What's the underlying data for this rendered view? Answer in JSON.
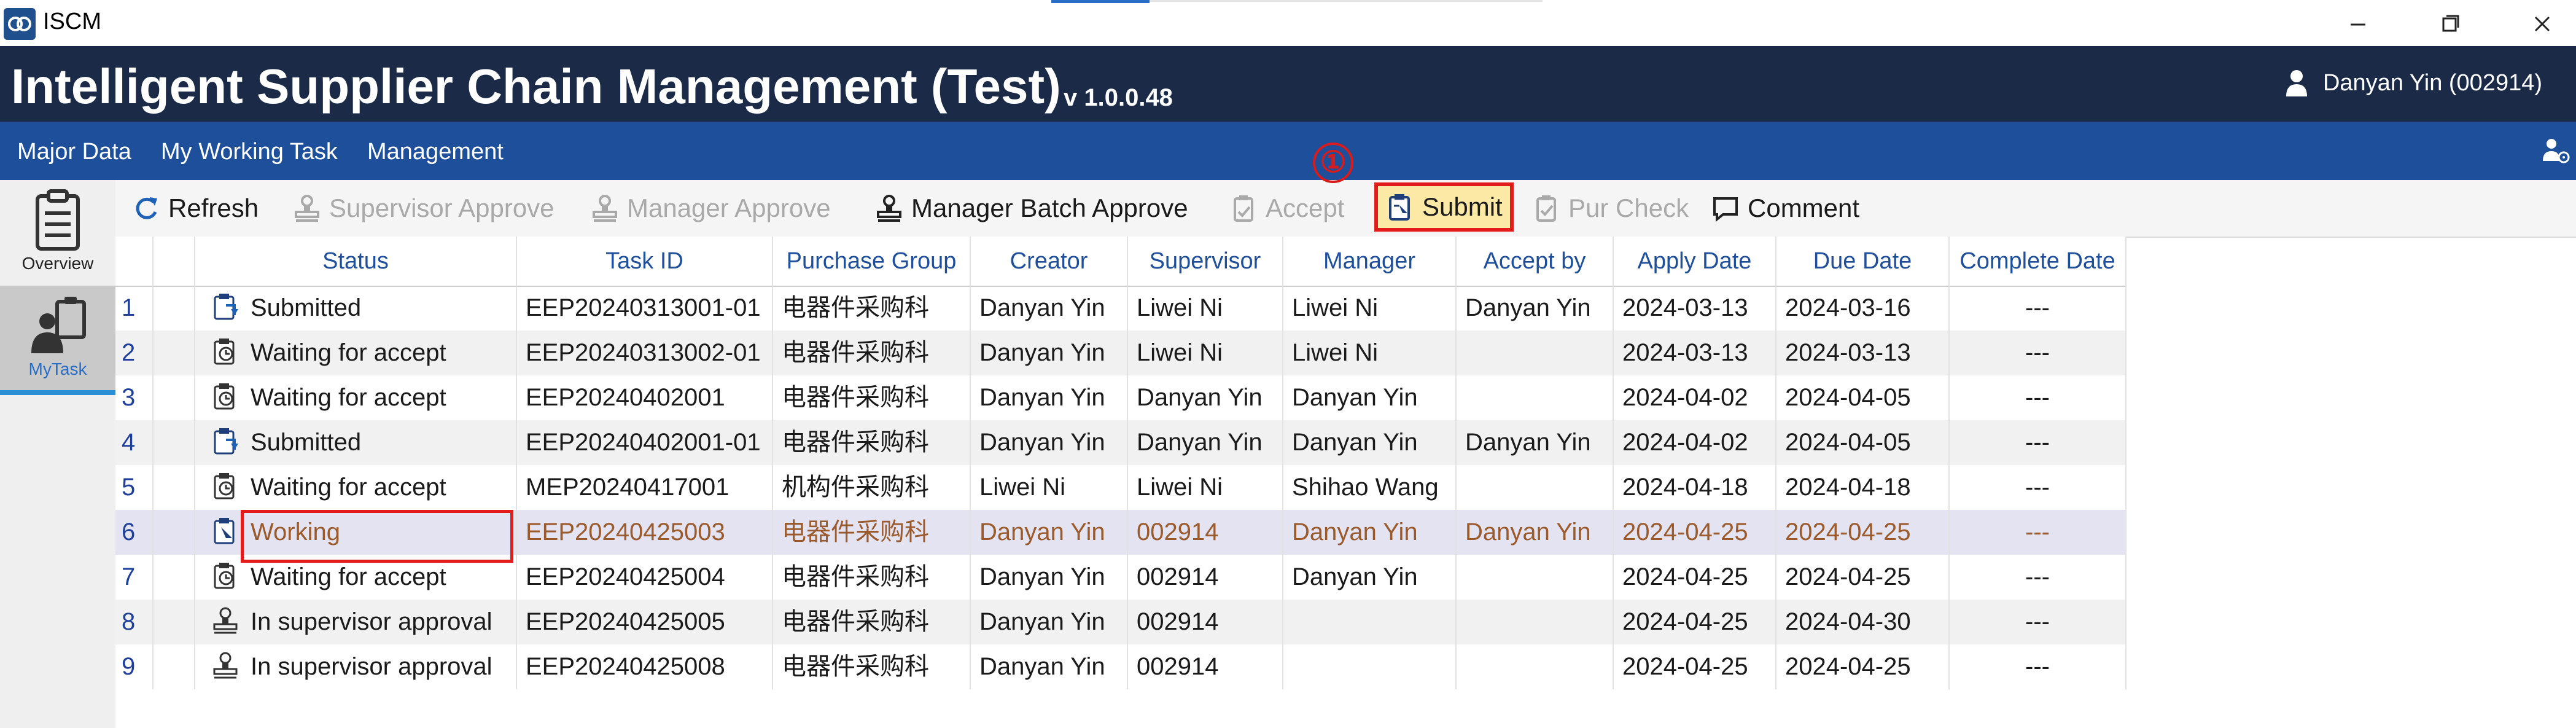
{
  "window": {
    "title": "ISCM",
    "minimize_icon": "minimize-icon",
    "maximize_icon": "restore-icon",
    "close_icon": "close-icon"
  },
  "header": {
    "title": "Intelligent Supplier Chain Management (Test)",
    "version": "v 1.0.0.48",
    "user": "Danyan Yin (002914)"
  },
  "menu": {
    "items": [
      "Major Data",
      "My Working Task",
      "Management"
    ]
  },
  "nav": {
    "items": [
      {
        "label": "Overview",
        "icon": "clipboard-icon"
      },
      {
        "label": "MyTask",
        "icon": "person-task-icon"
      }
    ]
  },
  "toolbar": {
    "refresh": "Refresh",
    "supervisor_approve": "Supervisor Approve",
    "manager_approve": "Manager Approve",
    "manager_batch_approve": "Manager Batch Approve",
    "accept": "Accept",
    "submit": "Submit",
    "pur_check": "Pur Check",
    "comment": "Comment",
    "callout": "①"
  },
  "table": {
    "columns": [
      "Status",
      "Task ID",
      "Purchase Group",
      "Creator",
      "Supervisor",
      "Manager",
      "Accept by",
      "Apply Date",
      "Due Date",
      "Complete Date"
    ],
    "rows": [
      {
        "num": "1",
        "status_icon": "submitted",
        "status": "Submitted",
        "task_id": "EEP20240313001-01",
        "group": "电器件采购科",
        "creator": "Danyan Yin",
        "supervisor": "Liwei Ni",
        "manager": "Liwei Ni",
        "accept_by": "Danyan Yin",
        "apply": "2024-03-13",
        "due": "2024-03-16",
        "complete": "---"
      },
      {
        "num": "2",
        "status_icon": "waiting",
        "status": "Waiting for accept",
        "task_id": "EEP20240313002-01",
        "group": "电器件采购科",
        "creator": "Danyan Yin",
        "supervisor": "Liwei Ni",
        "manager": "Liwei Ni",
        "accept_by": "",
        "apply": "2024-03-13",
        "due": "2024-03-13",
        "complete": "---"
      },
      {
        "num": "3",
        "status_icon": "waiting",
        "status": "Waiting for accept",
        "task_id": "EEP20240402001",
        "group": "电器件采购科",
        "creator": "Danyan Yin",
        "supervisor": "Danyan Yin",
        "manager": "Danyan Yin",
        "accept_by": "",
        "apply": "2024-04-02",
        "due": "2024-04-05",
        "complete": "---"
      },
      {
        "num": "4",
        "status_icon": "submitted",
        "status": "Submitted",
        "task_id": "EEP20240402001-01",
        "group": "电器件采购科",
        "creator": "Danyan Yin",
        "supervisor": "Danyan Yin",
        "manager": "Danyan Yin",
        "accept_by": "Danyan Yin",
        "apply": "2024-04-02",
        "due": "2024-04-05",
        "complete": "---"
      },
      {
        "num": "5",
        "status_icon": "waiting",
        "status": "Waiting for accept",
        "task_id": "MEP20240417001",
        "group": "机构件采购科",
        "creator": "Liwei Ni",
        "supervisor": "Liwei Ni",
        "manager": "Shihao Wang",
        "accept_by": "",
        "apply": "2024-04-18",
        "due": "2024-04-18",
        "complete": "---"
      },
      {
        "num": "6",
        "status_icon": "working",
        "status": "Working",
        "task_id": "EEP20240425003",
        "group": "电器件采购科",
        "creator": "Danyan Yin",
        "supervisor": "002914",
        "manager": "Danyan Yin",
        "accept_by": "Danyan Yin",
        "apply": "2024-04-25",
        "due": "2024-04-25",
        "complete": "---"
      },
      {
        "num": "7",
        "status_icon": "waiting",
        "status": "Waiting for accept",
        "task_id": "EEP20240425004",
        "group": "电器件采购科",
        "creator": "Danyan Yin",
        "supervisor": "002914",
        "manager": "Danyan Yin",
        "accept_by": "",
        "apply": "2024-04-25",
        "due": "2024-04-25",
        "complete": "---"
      },
      {
        "num": "8",
        "status_icon": "approval",
        "status": "In supervisor approval",
        "task_id": "EEP20240425005",
        "group": "电器件采购科",
        "creator": "Danyan Yin",
        "supervisor": "002914",
        "manager": "",
        "accept_by": "",
        "apply": "2024-04-25",
        "due": "2024-04-30",
        "complete": "---"
      },
      {
        "num": "9",
        "status_icon": "approval",
        "status": "In supervisor approval",
        "task_id": "EEP20240425008",
        "group": "电器件采购科",
        "creator": "Danyan Yin",
        "supervisor": "002914",
        "manager": "",
        "accept_by": "",
        "apply": "2024-04-25",
        "due": "2024-04-25",
        "complete": "---"
      }
    ]
  }
}
